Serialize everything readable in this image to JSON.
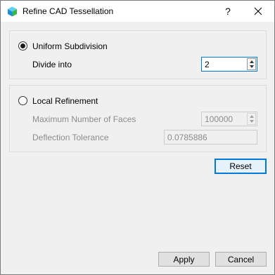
{
  "window": {
    "title": "Refine CAD Tessellation",
    "help_label": "?",
    "app_icon": "cube-logo-icon",
    "close_icon": "close-icon"
  },
  "uniform": {
    "label": "Uniform Subdivision",
    "selected": true,
    "divide_label": "Divide into",
    "divide_value": "2"
  },
  "local": {
    "label": "Local Refinement",
    "selected": false,
    "max_faces_label": "Maximum Number of Faces",
    "max_faces_value": "100000",
    "deflection_label": "Deflection Tolerance",
    "deflection_value": "0.0785886"
  },
  "buttons": {
    "reset": "Reset",
    "apply": "Apply",
    "cancel": "Cancel"
  },
  "colors": {
    "accent": "#0078d7",
    "disabled_text": "#8c8c8c"
  }
}
